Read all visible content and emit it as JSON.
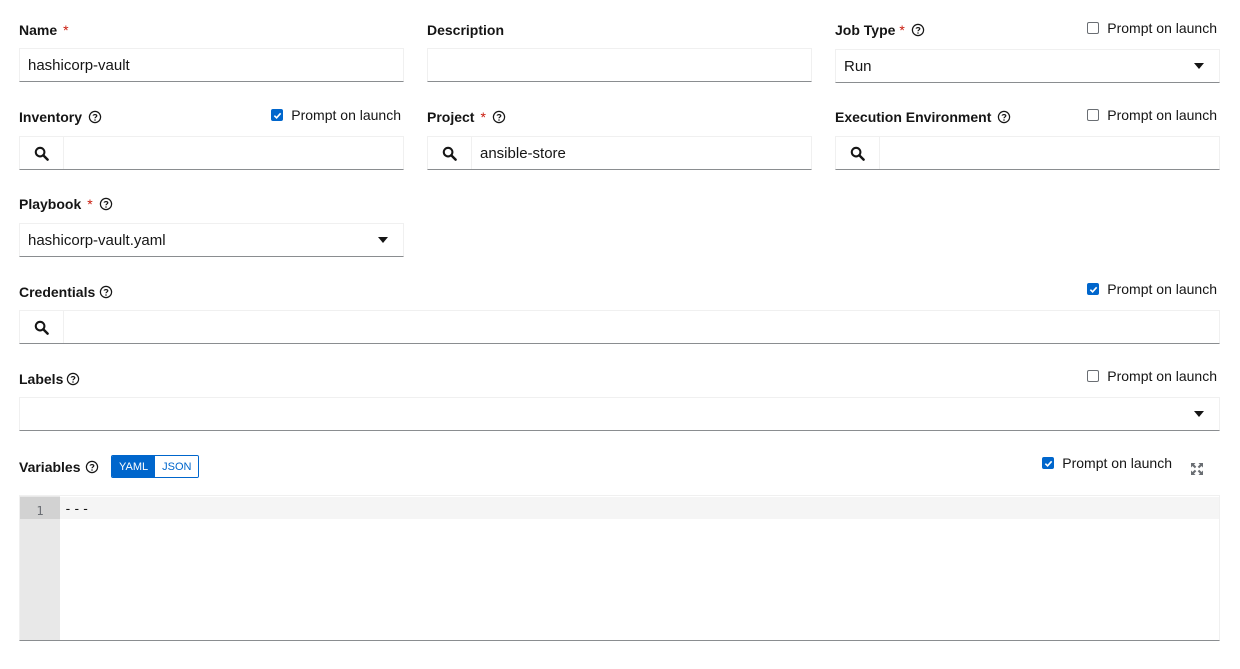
{
  "name": {
    "label": "Name",
    "required": "*",
    "value": "hashicorp-vault"
  },
  "description": {
    "label": "Description",
    "value": ""
  },
  "job_type": {
    "label": "Job Type",
    "required": "*",
    "value": "Run",
    "prompt": "Prompt on launch",
    "prompt_checked": false
  },
  "inventory": {
    "label": "Inventory",
    "value": "",
    "prompt": "Prompt on launch",
    "prompt_checked": true
  },
  "project": {
    "label": "Project",
    "required": "*",
    "value": "ansible-store"
  },
  "execution_environment": {
    "label": "Execution Environment",
    "value": "",
    "prompt": "Prompt on launch",
    "prompt_checked": false
  },
  "playbook": {
    "label": "Playbook",
    "required": "*",
    "value": "hashicorp-vault.yaml"
  },
  "credentials": {
    "label": "Credentials",
    "value": "",
    "prompt": "Prompt on launch",
    "prompt_checked": true
  },
  "labels": {
    "label": "Labels",
    "value": "",
    "prompt": "Prompt on launch",
    "prompt_checked": false
  },
  "variables": {
    "label": "Variables",
    "toggle": [
      "YAML",
      "JSON"
    ],
    "active_format": "YAML",
    "prompt": "Prompt on launch",
    "prompt_checked": true,
    "lines": [
      {
        "number": "1",
        "text": "---"
      }
    ]
  },
  "icons": {
    "help": "question-circle-icon",
    "search": "search-icon",
    "caret": "caret-down-icon",
    "checkbox": "checkmark-icon",
    "expand": "expand-icon"
  },
  "colors": {
    "accent": "#0066cc",
    "required": "#c9190b",
    "text": "#151515"
  }
}
